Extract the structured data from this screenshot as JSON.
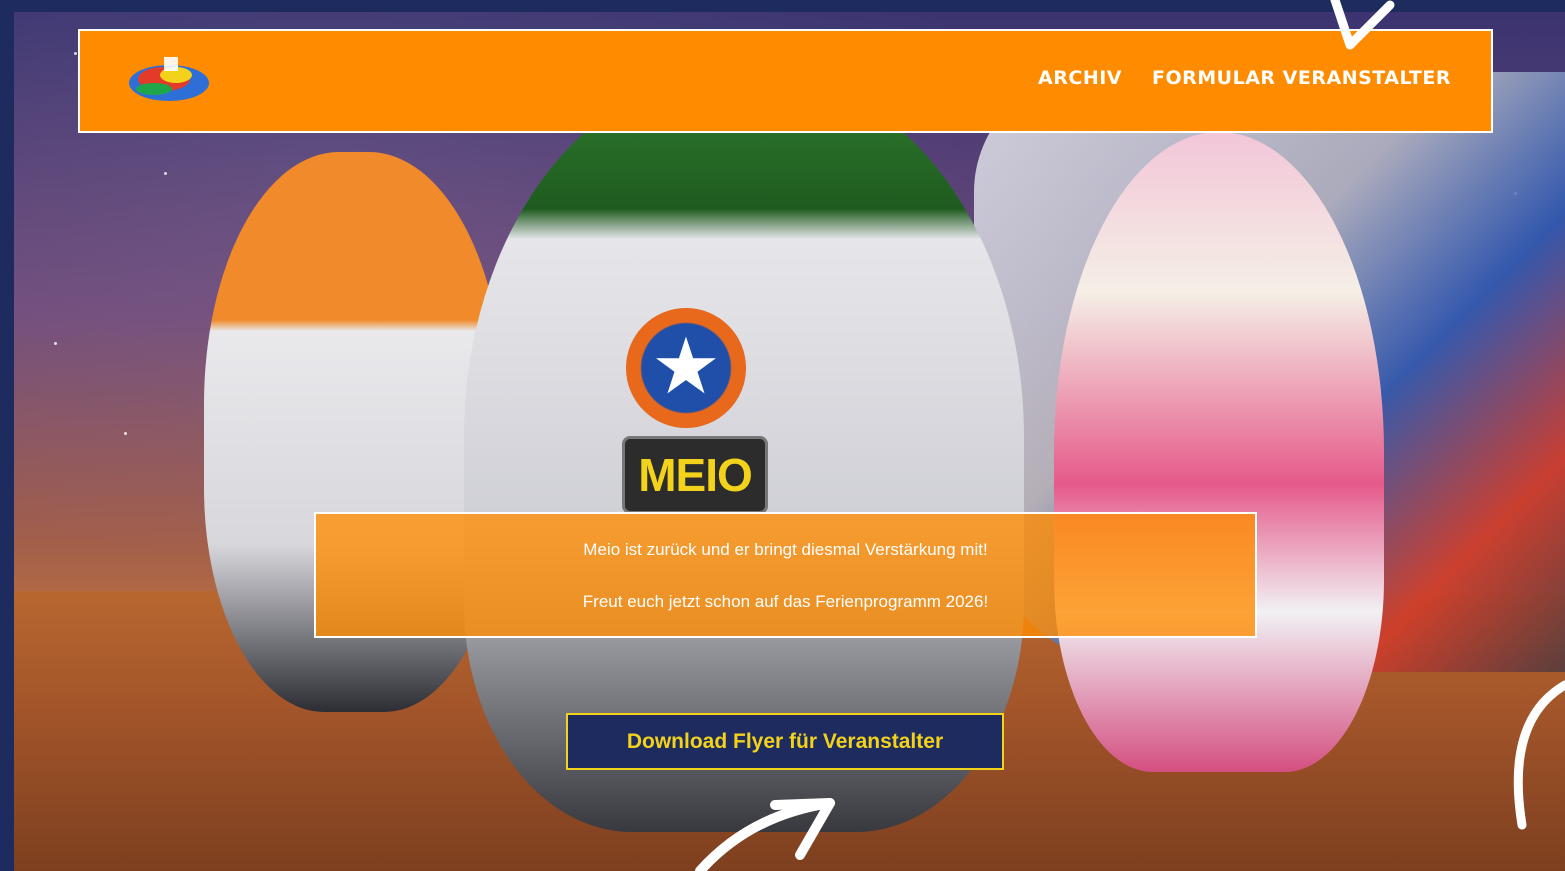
{
  "header": {
    "logo_icon": "colorful-rocket-logo-icon",
    "nav": [
      {
        "label": "ARCHIV"
      },
      {
        "label": "FORMULAR VERANSTALTER"
      }
    ],
    "background_color": "#ff8c00"
  },
  "hero": {
    "badge_text": "MEIO",
    "message_line1": "Meio ist zurück und er bringt diesmal Verstärkung mit!",
    "message_line2": "Freut euch jetzt schon auf das Ferienprogramm 2026!",
    "cta_label": "Download Flyer für Veranstalter"
  },
  "colors": {
    "frame": "#1d2b5f",
    "accent_orange": "#ff8c00",
    "cta_text": "#f3d21c"
  }
}
